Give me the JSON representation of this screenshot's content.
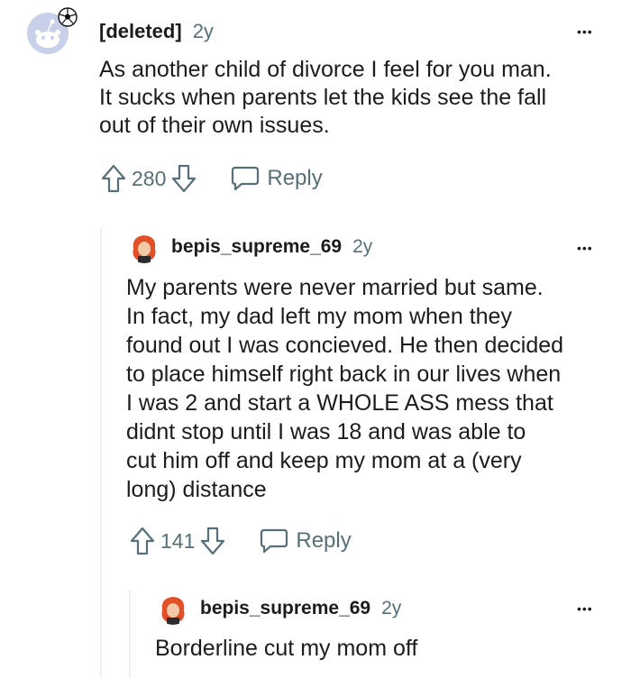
{
  "comments": [
    {
      "author": "[deleted]",
      "age": "2y",
      "body": "As another child of divorce I feel for you man.\nIt sucks when parents let the kids see the fall\nout of their own issues.",
      "votes": "280",
      "reply_label": "Reply",
      "more_label": "•••"
    },
    {
      "author": "bepis_supreme_69",
      "age": "2y",
      "body": "My parents were never married but same.\nIn fact, my dad left my mom when they\nfound out I was concieved. He then decided\nto place himself right back in our lives when\nI was 2 and start a WHOLE ASS mess that\ndidnt stop until I was 18 and was able to\ncut him off and keep my mom at a (very\nlong) distance",
      "votes": "141",
      "reply_label": "Reply",
      "more_label": "•••"
    },
    {
      "author": "bepis_supreme_69",
      "age": "2y",
      "body": "Borderline cut my mom off",
      "more_label": "•••"
    }
  ],
  "colors": {
    "text": "#1c1c1c",
    "meta": "#576f76",
    "avatar_bg": "#c9d1ea",
    "avatar_hair": "#e2502a"
  },
  "icons": {
    "upvote": "arrow-up-icon",
    "downvote": "arrow-down-icon",
    "reply": "speech-bubble-icon",
    "more": "ellipsis-icon",
    "default_avatar": "snoo-avatar-icon",
    "user_avatar": "red-hair-avatar-icon"
  }
}
